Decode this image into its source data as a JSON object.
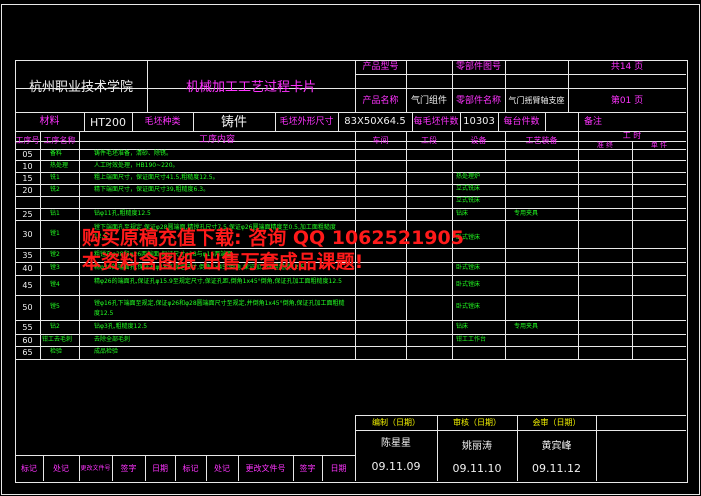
{
  "header": {
    "school": "杭州职业技术学院",
    "card_title": "机械加工工艺过程卡片",
    "product_model_label": "产品型号",
    "product_name_label": "产品名称",
    "product_name": "气门组件",
    "part_no_label": "零部件图号",
    "part_name_label": "零部件名称",
    "part_name": "气门摇臂轴支座",
    "total_pages": "共14 页",
    "page_no": "第01 页"
  },
  "material_row": {
    "material_label": "材料",
    "material": "HT200",
    "blank_type_label": "毛坯种类",
    "blank_type": "铸件",
    "blank_size_label": "毛坯外形尺寸",
    "blank_size": "83X50X64.5",
    "per_blank_label": "每毛坯件数",
    "per_blank": "10303",
    "per_unit_label": "每台件数",
    "remark_label": "备注"
  },
  "columns": {
    "op_no": "工序号",
    "op_name": "工序名称",
    "op_content": "工序内容",
    "workshop": "车间",
    "section": "工段",
    "equipment": "设备",
    "tooling": "工艺装备",
    "hours": "工 时",
    "prep_final": "准 终",
    "unit": "单 件"
  },
  "rows": [
    {
      "no": "05",
      "name": "备料",
      "content": "铸件毛坯准备，清砂、除锈。",
      "equip": "",
      "tool": ""
    },
    {
      "no": "10",
      "name": "热处理",
      "content": "人工时效处理，HB190~220。",
      "equip": "热处理炉",
      "tool": ""
    },
    {
      "no": "15",
      "name": "铣1",
      "content": "粗上端面尺寸，保证面尺寸41.5,粗糙度12.5。",
      "equip": "立式铣床",
      "tool": ""
    },
    {
      "no": "20",
      "name": "铣2",
      "content": "精下端面尺寸，保证面尺寸39,粗糙度6.3。",
      "equip": "立式铣床",
      "tool": ""
    },
    {
      "no": "25",
      "name": "钻1",
      "content": "钻φ11孔,粗糙度12.5",
      "equip": "钻床",
      "tool": "专用夹具"
    },
    {
      "no": "30",
      "name": "镗1",
      "content": "镗下端面孔至规定,保证φ28圆端面,精镗孔尺寸7.5,保证φ26圆端面精度至0.5,加工面粗糙度12.5",
      "equip": "卧式镗床",
      "tool": ""
    },
    {
      "no": "35",
      "name": "镗2",
      "content": "粗镗孔φ28和φ26两端面,保证尺寸φ18与φ16两端面",
      "equip": "",
      "tool": ""
    },
    {
      "no": "40",
      "name": "镗3",
      "content": "精φ28的端面孔,保证孔φ18至规定尺寸,倒角1x45°倒角,保证加工面粗糙度12.5",
      "equip": "卧式镗床",
      "tool": ""
    },
    {
      "no": "45",
      "name": "镗4",
      "content": "精φ26的端面孔,保证孔φ15.9至规定尺寸,保证孔距,倒角1x45°倒角,保证孔加工面粗糙度12.5",
      "equip": "卧式镗床",
      "tool": ""
    },
    {
      "no": "50",
      "name": "镗5",
      "content": "镗φ16孔下端面至规定,保证φ26和φ28圆端面尺寸至规定,并倒角1x45°倒角,保证孔加工面粗糙度12.5",
      "equip": "卧式镗床",
      "tool": ""
    },
    {
      "no": "55",
      "name": "钻2",
      "content": "钻φ3孔,粗糙度12.5",
      "equip": "钻床",
      "tool": "专用夹具"
    },
    {
      "no": "60",
      "name": "钳工去毛刺",
      "content": "去除全部毛刺",
      "equip": "钳工工作台",
      "tool": ""
    },
    {
      "no": "65",
      "name": "检验",
      "content": "成品检验",
      "equip": "",
      "tool": ""
    }
  ],
  "signoff": {
    "compile_label": "编制（日期）",
    "review_label": "审核（日期）",
    "sign_label": "会审（日期）",
    "compiler": "陈星星",
    "reviewer": "姚丽涛",
    "signer": "黄宾峰",
    "compile_date": "09.11.09",
    "review_date": "09.11.10",
    "sign_date": "09.11.12"
  },
  "footer_labels": [
    "标记",
    "处记",
    "更改文件号",
    "签字",
    "日期",
    "标记",
    "处记",
    "更改文件号",
    "签字",
    "日期"
  ],
  "watermark": {
    "line1": "购买原稿充值下载: 咨询 QQ 1062521905",
    "line2": "本资料含图纸 出售万套成品课题!"
  },
  "colors": {
    "frame": "#e8e8e8",
    "label": "#ff33ff",
    "value": "#f0f0f0",
    "content": "#22ff22",
    "signoff": "#f5f500",
    "watermark": "#ff1a1a"
  }
}
